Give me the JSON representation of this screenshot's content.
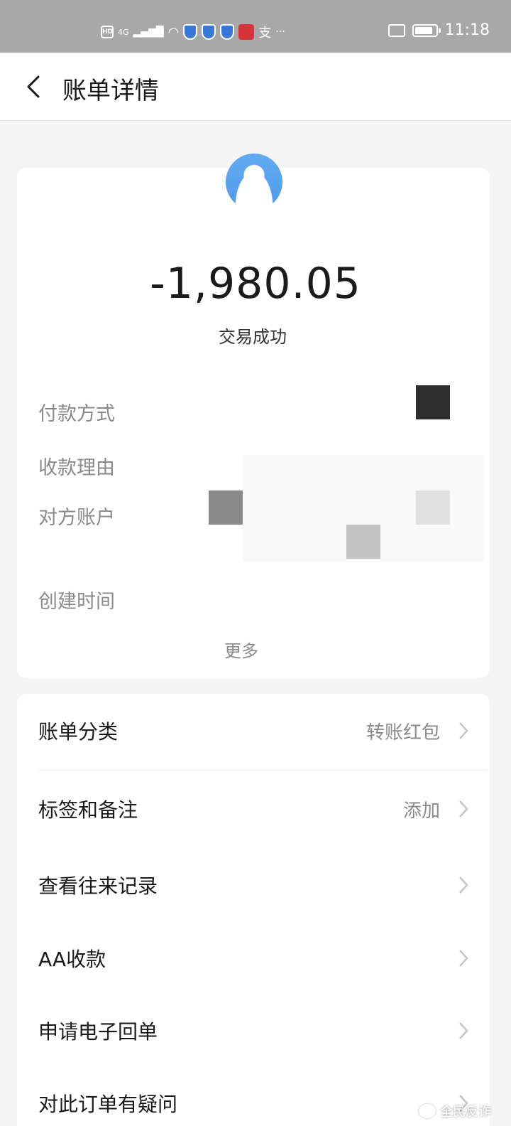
{
  "status_bar": {
    "hd_badge": "HD",
    "network": "4G",
    "more": "···",
    "time": "11:18"
  },
  "header": {
    "title": "账单详情"
  },
  "transaction": {
    "amount": "-1,980.05",
    "status": "交易成功",
    "details": [
      {
        "label": "付款方式"
      },
      {
        "label": "收款理由"
      },
      {
        "label": "对方账户"
      },
      {
        "label": "创建时间"
      }
    ],
    "more_label": "更多"
  },
  "options": [
    {
      "label": "账单分类",
      "value": "转账红包"
    },
    {
      "label": "标签和备注",
      "value": "添加"
    },
    {
      "label": "查看往来记录",
      "value": ""
    },
    {
      "label": "AA收款",
      "value": ""
    },
    {
      "label": "申请电子回单",
      "value": ""
    },
    {
      "label": "对此订单有疑问",
      "value": ""
    }
  ],
  "watermark": {
    "text": "全民反诈"
  },
  "colors": {
    "status_bar_bg": "#a8a8a8",
    "avatar_blue": "#3a8ee8",
    "text_primary": "#1a1a1a",
    "text_secondary": "#8a8a8a"
  }
}
